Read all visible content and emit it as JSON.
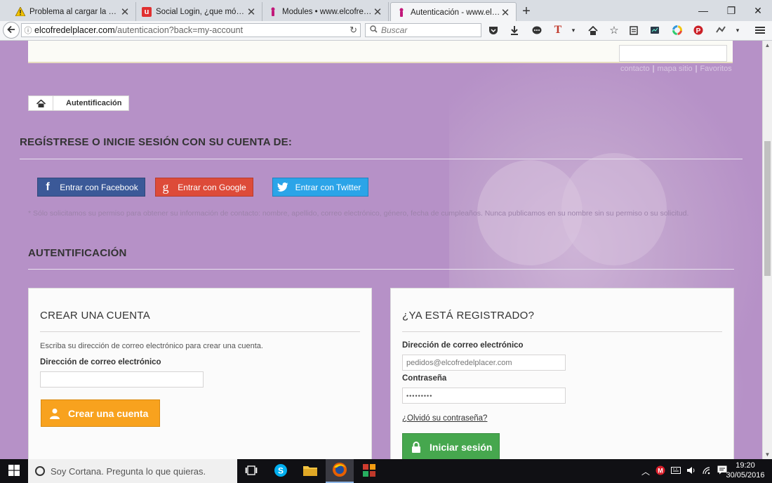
{
  "browser": {
    "tabs": [
      {
        "title": "Problema al cargar la pági...",
        "icon": "warning-icon"
      },
      {
        "title": "Social Login, ¿que módul...",
        "icon": "site-u-icon"
      },
      {
        "title": "Modules • www.elcofredel...",
        "icon": "prestashop-icon"
      },
      {
        "title": "Autenticación - www.elco...",
        "icon": "prestashop-icon",
        "active": true
      }
    ],
    "url_host": "elcofredelplacer.com",
    "url_path": "/autenticacion?back=my-account",
    "search_placeholder": "Buscar"
  },
  "page": {
    "top_links": [
      "contacto",
      "mapa sitio",
      "Favoritos"
    ],
    "breadcrumb": {
      "current": "Autentificación"
    },
    "social_title": "REGÍSTRESE O INICIE SESIÓN CON SU CUENTA DE:",
    "social_buttons": {
      "facebook": "Entrar con Facebook",
      "google": "Entrar con Google",
      "twitter": "Entrar con Twitter"
    },
    "social_note": "* Sólo solicitamos su permiso para obtener su información de contacto: nombre, apellido, correo electrónico, género, fecha de cumpleaños. Nunca publicamos en su nombre sin su permiso o su solicitud.",
    "auth_title": "AUTENTIFICACIÓN",
    "create_account": {
      "heading": "CREAR UNA CUENTA",
      "description": "Escriba su dirección de correo electrónico para crear una cuenta.",
      "email_label": "Dirección de correo electrónico",
      "email_value": "",
      "button": "Crear una cuenta"
    },
    "login": {
      "heading": "¿YA ESTÁ REGISTRADO?",
      "email_label": "Dirección de correo electrónico",
      "email_value": "pedidos@elcofredelplacer.com",
      "password_label": "Contraseña",
      "password_value": "•••••••••",
      "forgot": "¿Olvidó su contraseña?",
      "button": "Iniciar sesión"
    }
  },
  "taskbar": {
    "cortana_placeholder": "Soy Cortana. Pregunta lo que quieras.",
    "time": "19:20",
    "date": "30/05/2016"
  },
  "colors": {
    "page_bg": "#b691c7",
    "facebook": "#3b5998",
    "google": "#dd4b39",
    "twitter": "#2ba4e8",
    "create_button": "#f8a21e",
    "login_button": "#46a74e"
  }
}
